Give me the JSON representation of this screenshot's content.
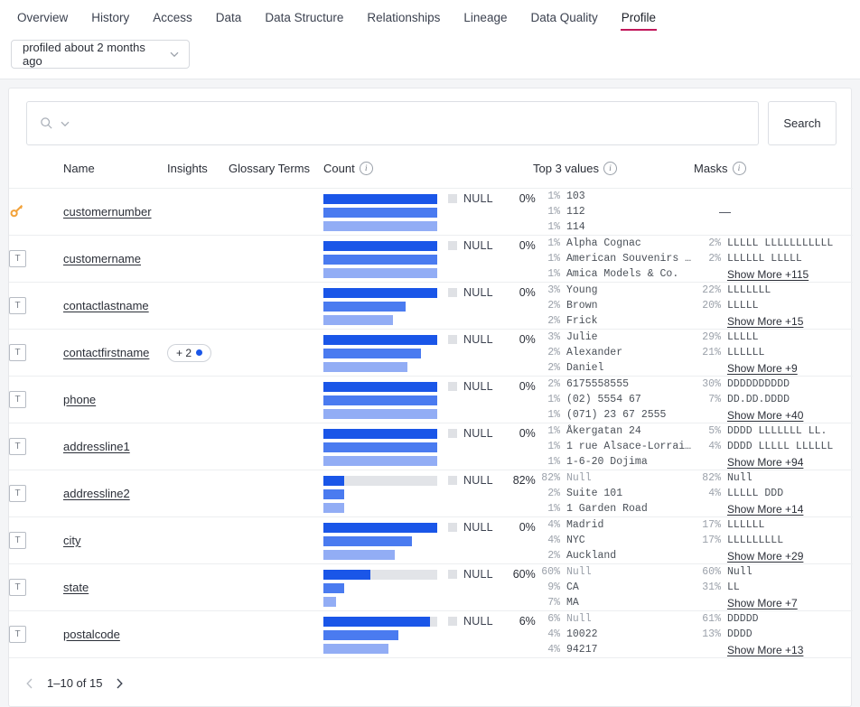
{
  "nav": {
    "tabs": [
      {
        "label": "Overview",
        "active": false
      },
      {
        "label": "History",
        "active": false
      },
      {
        "label": "Access",
        "active": false
      },
      {
        "label": "Data",
        "active": false
      },
      {
        "label": "Data Structure",
        "active": false
      },
      {
        "label": "Relationships",
        "active": false
      },
      {
        "label": "Lineage",
        "active": false
      },
      {
        "label": "Data Quality",
        "active": false
      },
      {
        "label": "Profile",
        "active": true
      }
    ],
    "active_underline_color": "#c2185b"
  },
  "profile_selector": {
    "value": "profiled about 2 months ago",
    "chevron_icon": "chevron-down-icon"
  },
  "search": {
    "value": "",
    "placeholder": "",
    "search_icon": "search-icon",
    "chevron_icon": "chevron-down-icon",
    "button_label": "Search"
  },
  "table": {
    "headers": {
      "icon": "",
      "name": "Name",
      "insights": "Insights",
      "glossary": "Glossary Terms",
      "count": "Count",
      "top_values": "Top 3 values",
      "masks": "Masks"
    },
    "bar_colors": [
      "#1a56e8",
      "#4a7bf0",
      "#92adf5"
    ],
    "null_track_color": "#e2e4e8",
    "null_label": "NULL",
    "rows": [
      {
        "icon": "key-icon",
        "name": "customernumber",
        "insights": null,
        "glossary": "",
        "bars": [
          100,
          100,
          100
        ],
        "null_pct": "0%",
        "null_fraction": 0,
        "top_values": [
          {
            "pct": "1%",
            "value": "103"
          },
          {
            "pct": "1%",
            "value": "112"
          },
          {
            "pct": "1%",
            "value": "114"
          }
        ],
        "masks": [],
        "masks_dash": "—",
        "show_more": null
      },
      {
        "icon": "text-type-icon",
        "name": "customername",
        "insights": null,
        "glossary": "",
        "bars": [
          100,
          100,
          100
        ],
        "null_pct": "0%",
        "null_fraction": 0,
        "top_values": [
          {
            "pct": "1%",
            "value": "Alpha Cognac"
          },
          {
            "pct": "1%",
            "value": "American Souvenirs …"
          },
          {
            "pct": "1%",
            "value": "Amica Models & Co."
          }
        ],
        "masks": [
          {
            "pct": "2%",
            "value": "LLLLL LLLLLLLLLLL"
          },
          {
            "pct": "2%",
            "value": "LLLLLL LLLLL"
          }
        ],
        "masks_dash": null,
        "show_more": "Show More +115"
      },
      {
        "icon": "text-type-icon",
        "name": "contactlastname",
        "insights": null,
        "glossary": "",
        "bars": [
          100,
          72,
          61
        ],
        "null_pct": "0%",
        "null_fraction": 0,
        "top_values": [
          {
            "pct": "3%",
            "value": "Young"
          },
          {
            "pct": "2%",
            "value": "Brown"
          },
          {
            "pct": "2%",
            "value": "Frick"
          }
        ],
        "masks": [
          {
            "pct": "22%",
            "value": "LLLLLLL"
          },
          {
            "pct": "20%",
            "value": "LLLLL"
          }
        ],
        "masks_dash": null,
        "show_more": "Show More +15"
      },
      {
        "icon": "text-type-icon",
        "name": "contactfirstname",
        "insights": "+ 2",
        "glossary": "",
        "bars": [
          100,
          86,
          74
        ],
        "null_pct": "0%",
        "null_fraction": 0,
        "top_values": [
          {
            "pct": "3%",
            "value": "Julie"
          },
          {
            "pct": "2%",
            "value": "Alexander"
          },
          {
            "pct": "2%",
            "value": "Daniel"
          }
        ],
        "masks": [
          {
            "pct": "29%",
            "value": "LLLLL"
          },
          {
            "pct": "21%",
            "value": "LLLLLL"
          }
        ],
        "masks_dash": null,
        "show_more": "Show More +9"
      },
      {
        "icon": "text-type-icon",
        "name": "phone",
        "insights": null,
        "glossary": "",
        "bars": [
          100,
          100,
          100
        ],
        "null_pct": "0%",
        "null_fraction": 0,
        "top_values": [
          {
            "pct": "2%",
            "value": "6175558555"
          },
          {
            "pct": "1%",
            "value": "(02) 5554 67"
          },
          {
            "pct": "1%",
            "value": "(071) 23 67 2555"
          }
        ],
        "masks": [
          {
            "pct": "30%",
            "value": "DDDDDDDDDD"
          },
          {
            "pct": "7%",
            "value": "DD.DD.DDDD"
          }
        ],
        "masks_dash": null,
        "show_more": "Show More +40"
      },
      {
        "icon": "text-type-icon",
        "name": "addressline1",
        "insights": null,
        "glossary": "",
        "bars": [
          100,
          100,
          100
        ],
        "null_pct": "0%",
        "null_fraction": 0,
        "top_values": [
          {
            "pct": "1%",
            "value": "Åkergatan 24"
          },
          {
            "pct": "1%",
            "value": "1 rue Alsace-Lorrai…"
          },
          {
            "pct": "1%",
            "value": "1-6-20 Dojima"
          }
        ],
        "masks": [
          {
            "pct": "5%",
            "value": "DDDD LLLLLLL LL."
          },
          {
            "pct": "4%",
            "value": "DDDD LLLLL LLLLLL"
          }
        ],
        "masks_dash": null,
        "show_more": "Show More +94"
      },
      {
        "icon": "text-type-icon",
        "name": "addressline2",
        "insights": null,
        "glossary": "",
        "bars": [
          18,
          18,
          18
        ],
        "null_pct": "82%",
        "null_fraction": 82,
        "top_values": [
          {
            "pct": "82%",
            "value": "Null",
            "muted": true
          },
          {
            "pct": "2%",
            "value": "Suite 101"
          },
          {
            "pct": "1%",
            "value": "1 Garden Road"
          }
        ],
        "masks": [
          {
            "pct": "82%",
            "value": "Null",
            "muted": true
          },
          {
            "pct": "4%",
            "value": "LLLLL DDD"
          }
        ],
        "masks_dash": null,
        "show_more": "Show More +14"
      },
      {
        "icon": "text-type-icon",
        "name": "city",
        "insights": null,
        "glossary": "",
        "bars": [
          100,
          78,
          63
        ],
        "null_pct": "0%",
        "null_fraction": 0,
        "top_values": [
          {
            "pct": "4%",
            "value": "Madrid"
          },
          {
            "pct": "4%",
            "value": "NYC"
          },
          {
            "pct": "2%",
            "value": "Auckland"
          }
        ],
        "masks": [
          {
            "pct": "17%",
            "value": "LLLLLL"
          },
          {
            "pct": "17%",
            "value": "LLLLLLLLL"
          }
        ],
        "masks_dash": null,
        "show_more": "Show More +29"
      },
      {
        "icon": "text-type-icon",
        "name": "state",
        "insights": null,
        "glossary": "",
        "bars": [
          41,
          18,
          11
        ],
        "null_pct": "60%",
        "null_fraction": 60,
        "top_values": [
          {
            "pct": "60%",
            "value": "Null",
            "muted": true
          },
          {
            "pct": "9%",
            "value": "CA"
          },
          {
            "pct": "7%",
            "value": "MA"
          }
        ],
        "masks": [
          {
            "pct": "60%",
            "value": "Null",
            "muted": true
          },
          {
            "pct": "31%",
            "value": "LL"
          }
        ],
        "masks_dash": null,
        "show_more": "Show More +7"
      },
      {
        "icon": "text-type-icon",
        "name": "postalcode",
        "insights": null,
        "glossary": "",
        "bars": [
          94,
          66,
          57
        ],
        "null_pct": "6%",
        "null_fraction": 6,
        "top_values": [
          {
            "pct": "6%",
            "value": "Null",
            "muted": true
          },
          {
            "pct": "4%",
            "value": "10022"
          },
          {
            "pct": "4%",
            "value": "94217"
          }
        ],
        "masks": [
          {
            "pct": "61%",
            "value": "DDDDD"
          },
          {
            "pct": "13%",
            "value": "DDDD"
          }
        ],
        "masks_dash": null,
        "show_more": "Show More +13"
      }
    ]
  },
  "pagination": {
    "prev_icon": "chevron-left-icon",
    "next_icon": "chevron-right-icon",
    "range_label": "1–10 of 15"
  }
}
